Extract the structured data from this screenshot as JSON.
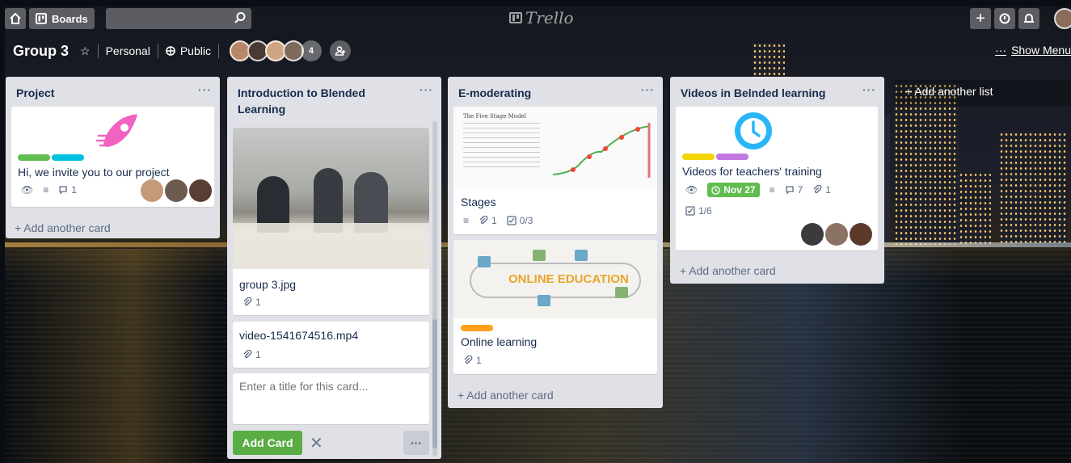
{
  "header": {
    "boards_label": "Boards",
    "search_placeholder": "",
    "logo_text": "Trello"
  },
  "board": {
    "title": "Group 3",
    "personal": "Personal",
    "visibility": "Public",
    "member_count": "4",
    "show_menu": "Show Menu",
    "show_menu_dots": "···"
  },
  "lists": [
    {
      "title": "Project",
      "cards": [
        {
          "title": "Hi, we invite you to our project",
          "labels": [
            "#61bd4f",
            "#00c2e0"
          ],
          "comments": "1"
        }
      ],
      "add_card": "+ Add another card"
    },
    {
      "title": "Introduction to Blended Learning",
      "cards": [
        {
          "title": "group 3.jpg",
          "attachments": "1"
        },
        {
          "title": "video-1541674516.mp4",
          "attachments": "1"
        }
      ],
      "composer_placeholder": "Enter a title for this card...",
      "add_button": "Add Card"
    },
    {
      "title": "E-moderating",
      "cards": [
        {
          "title": "Stages",
          "attachments": "1",
          "checklist": "0/3",
          "cover_heading": "The Five Stage Model"
        },
        {
          "title": "Online learning",
          "attachments": "1",
          "labels": [
            "#ff9f1a"
          ],
          "cover_heading": "ONLINE EDUCATION"
        }
      ],
      "add_card": "+ Add another card"
    },
    {
      "title": "Videos in Belnded learning",
      "cards": [
        {
          "title": "Videos for teachers' training",
          "labels": [
            "#f2d600",
            "#c377e0"
          ],
          "due": "Nov 27",
          "comments": "7",
          "attachments": "1",
          "checklist": "1/6"
        }
      ],
      "add_card": "+ Add another card"
    }
  ],
  "add_list": "+ Add another list",
  "colors": {
    "accent_green": "#5aac44",
    "list_bg": "#dfe1e6",
    "due_green": "#61bd4f"
  }
}
